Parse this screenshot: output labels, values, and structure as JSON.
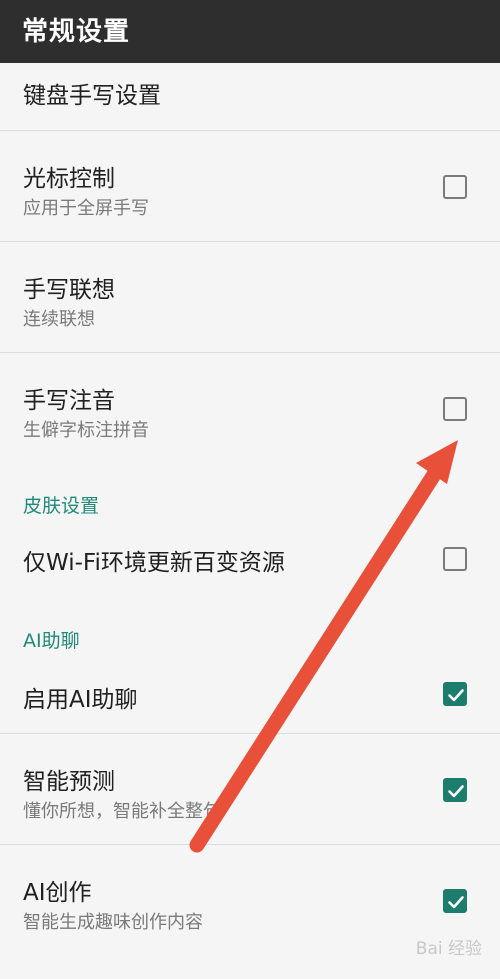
{
  "header": {
    "title": "常规设置"
  },
  "rows": {
    "keyboard": {
      "title": "键盘手写设置"
    },
    "cursor": {
      "title": "光标控制",
      "subtitle": "应用于全屏手写",
      "checked": false
    },
    "assoc": {
      "title": "手写联想",
      "subtitle": "连续联想"
    },
    "pinyin": {
      "title": "手写注音",
      "subtitle": "生僻字标注拼音",
      "checked": false
    },
    "wifi": {
      "title": "仅Wi-Fi环境更新百变资源",
      "checked": false
    },
    "enable_ai": {
      "title": "启用AI助聊",
      "checked": true
    },
    "predict": {
      "title": "智能预测",
      "subtitle": "懂你所想，智能补全整句",
      "checked": true
    },
    "create": {
      "title": "AI创作",
      "subtitle": "智能生成趣味创作内容",
      "checked": true
    }
  },
  "sections": {
    "skin": "皮肤设置",
    "ai": "AI助聊"
  },
  "watermark": "Bai 经验",
  "colors": {
    "accent": "#1c7d6d",
    "appbar": "#2e2e2e",
    "arrow": "#e8503a",
    "section": "#1f8a78"
  }
}
